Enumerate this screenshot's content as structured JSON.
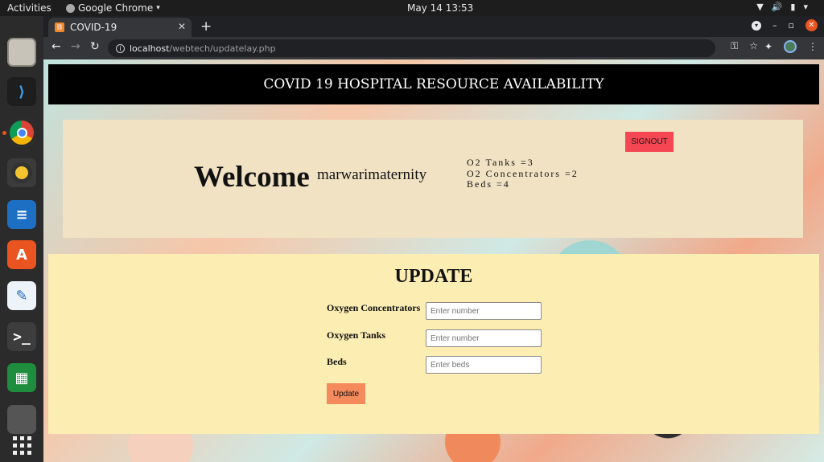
{
  "system": {
    "activities": "Activities",
    "app_name": "Google Chrome",
    "clock": "May 14  13:53"
  },
  "browser": {
    "tab_title": "COVID-19",
    "url_host": "localhost",
    "url_path": "/webtech/updatelay.php"
  },
  "page": {
    "header_title": "COVID 19 HOSPITAL RESOURCE AVAILABILITY",
    "signout_label": "SIGNOUT",
    "welcome_label": "Welcome",
    "username": "marwarimaternity",
    "stats": {
      "o2_tanks": "O2 Tanks =3",
      "o2_concentrators": "O2 Concentrators =2",
      "beds": "Beds =4"
    },
    "update": {
      "title": "UPDATE",
      "fields": [
        {
          "label": "Oxygen Concentrators",
          "placeholder": "Enter number"
        },
        {
          "label": "Oxygen Tanks",
          "placeholder": "Enter number"
        },
        {
          "label": "Beds",
          "placeholder": "Enter beds"
        }
      ],
      "button_label": "Update"
    }
  },
  "icons": [
    "files-icon",
    "vscode-icon",
    "chrome-icon",
    "rhythmbox-icon",
    "writer-icon",
    "software-store-icon",
    "text-editor-icon",
    "terminal-icon",
    "calc-icon",
    "trash-icon",
    "show-apps-icon"
  ]
}
